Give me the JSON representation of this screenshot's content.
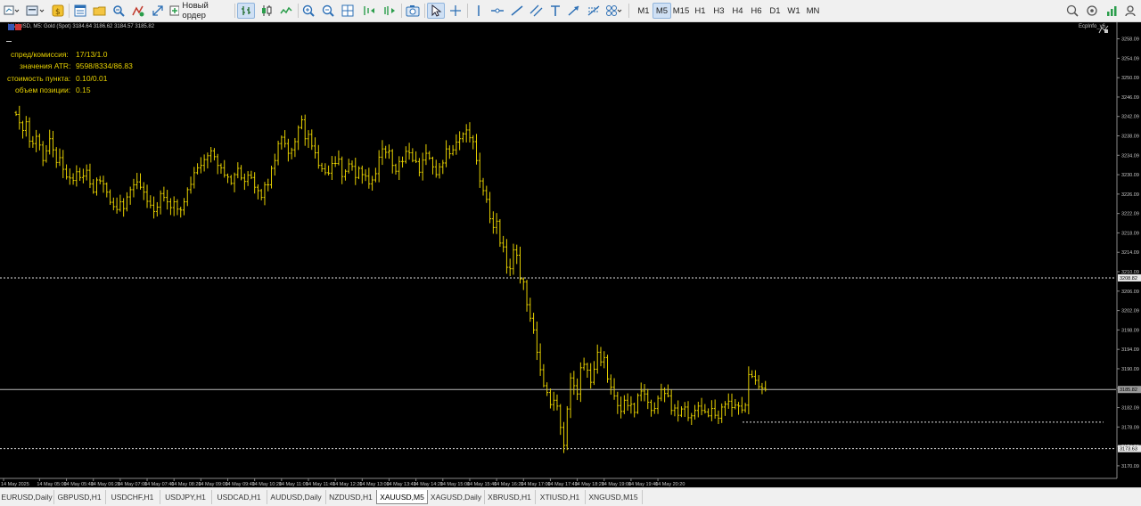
{
  "toolbar": {
    "new_order_label": "Новый ордер",
    "timeframes": [
      "M1",
      "M5",
      "M15",
      "H1",
      "H3",
      "H4",
      "H6",
      "D1",
      "W1",
      "MN"
    ],
    "active_timeframe": "M5"
  },
  "chart": {
    "header": "XAUUSD, M5:  Gold (Spot)  3184.64 3186.62 3184.57 3185.82",
    "indicator_name": "EcpInfo_v6",
    "info_panel": [
      {
        "label": "спред/комиссия:",
        "value": "17/13/1.0"
      },
      {
        "label": "значения ATR:",
        "value": "9598/8334/86.83"
      },
      {
        "label": "стоимость пункта:",
        "value": "0.10/0.01"
      },
      {
        "label": "объем позиции:",
        "value": "0.15"
      }
    ],
    "line_labels": {
      "upper": "3208.82",
      "current": "3185.82",
      "lower": "3173.63"
    },
    "colors": {
      "background": "#000000",
      "bars": "#e6d000",
      "axis_text": "#c8c8c8"
    }
  },
  "chart_data": {
    "type": "ohlc",
    "symbol": "XAUUSD",
    "timeframe": "M5",
    "y_axis_ticks": [
      3258.09,
      3254.09,
      3250.09,
      3246.09,
      3242.09,
      3238.09,
      3234.09,
      3230.09,
      3226.09,
      3222.09,
      3218.09,
      3214.09,
      3210.09,
      3206.09,
      3202.09,
      3198.09,
      3194.09,
      3190.09,
      3186.09,
      3182.09,
      3178.09,
      3174.09,
      3170.09
    ],
    "x_axis_ticks": [
      "14 May 2025",
      "14 May 05:00",
      "14 May 05:40",
      "14 May 06:20",
      "14 May 07:00",
      "14 May 07:40",
      "14 May 08:20",
      "14 May 09:00",
      "14 May 09:40",
      "14 May 10:20",
      "14 May 11:00",
      "14 May 11:40",
      "14 May 12:20",
      "14 May 13:00",
      "14 May 13:40",
      "14 May 14:20",
      "14 May 15:00",
      "14 May 15:40",
      "14 May 16:20",
      "14 May 17:00",
      "14 May 17:40",
      "14 May 18:20",
      "14 May 19:00",
      "14 May 19:40",
      "14 May 20:20"
    ],
    "horizontal_levels": [
      3208.82,
      3185.82,
      3173.63
    ],
    "dotted_range_line": 3179.1,
    "ylim": [
      3167.5,
      3261.5
    ],
    "closes": [
      3242.5,
      3240.8,
      3239.2,
      3241.0,
      3237.0,
      3236.5,
      3238.0,
      3236.2,
      3233.0,
      3235.0,
      3237.5,
      3235.2,
      3232.6,
      3233.6,
      3231.2,
      3229.6,
      3229.4,
      3228.9,
      3230.7,
      3229.5,
      3229.8,
      3231.0,
      3228.2,
      3226.5,
      3229.0,
      3228.8,
      3228.2,
      3226.5,
      3224.4,
      3223.5,
      3222.9,
      3224.5,
      3223.1,
      3225.5,
      3227.0,
      3228.0,
      3228.6,
      3227.5,
      3226.5,
      3224.6,
      3223.8,
      3222.5,
      3223.4,
      3226.2,
      3225.4,
      3224.5,
      3223.3,
      3224.5,
      3223.0,
      3222.8,
      3224.5,
      3227.0,
      3228.1,
      3230.5,
      3231.5,
      3232.0,
      3233.2,
      3234.0,
      3235.0,
      3233.8,
      3232.0,
      3231.5,
      3230.0,
      3229.6,
      3228.3,
      3230.1,
      3231.4,
      3229.4,
      3228.7,
      3230.0,
      3229.5,
      3227.5,
      3226.8,
      3225.4,
      3228.0,
      3228.0,
      3231.4,
      3233.0,
      3236.5,
      3237.8,
      3236.5,
      3234.5,
      3235.2,
      3236.9,
      3239.8,
      3241.4,
      3237.5,
      3238.4,
      3236.0,
      3234.6,
      3232.0,
      3231.3,
      3230.5,
      3230.4,
      3232.4,
      3232.4,
      3233.3,
      3229.7,
      3230.8,
      3232.3,
      3231.8,
      3229.5,
      3231.4,
      3230.1,
      3229.8,
      3228.2,
      3229.0,
      3230.3,
      3233.7,
      3235.4,
      3234.7,
      3235.0,
      3232.0,
      3230.8,
      3232.8,
      3232.8,
      3234.9,
      3234.6,
      3233.0,
      3232.8,
      3230.6,
      3233.1,
      3234.5,
      3233.5,
      3231.7,
      3230.1,
      3231.7,
      3232.5,
      3235.4,
      3234.4,
      3235.2,
      3236.8,
      3237.5,
      3238.5,
      3239.3,
      3237.7,
      3236.9,
      3233.0,
      3228.8,
      3226.8,
      3225.0,
      3221.0,
      3219.2,
      3220.5,
      3216.0,
      3215.2,
      3211.0,
      3210.7,
      3214.6,
      3213.5,
      3208.6,
      3208.0,
      3203.3,
      3200.5,
      3198.1,
      3193.5,
      3189.9,
      3186.6,
      3185.2,
      3182.7,
      3183.6,
      3182.4,
      3178.0,
      3174.3,
      3181.8,
      3188.2,
      3186.6,
      3184.9,
      3190.3,
      3191.0,
      3189.8,
      3187.3,
      3190.0,
      3193.5,
      3191.5,
      3192.4,
      3188.0,
      3186.3,
      3184.5,
      3182.5,
      3181.3,
      3183.6,
      3182.5,
      3182.8,
      3181.1,
      3184.6,
      3185.5,
      3184.9,
      3183.2,
      3181.5,
      3181.9,
      3184.0,
      3185.8,
      3185.0,
      3184.5,
      3181.5,
      3182.0,
      3180.5,
      3181.8,
      3182.2,
      3180.0,
      3180.4,
      3181.5,
      3182.4,
      3181.5,
      3181.2,
      3180.4,
      3181.9,
      3180.5,
      3179.9,
      3182.2,
      3182.8,
      3183.4,
      3182.1,
      3182.6,
      3182.4,
      3181.6,
      3182.6,
      3188.9,
      3188.5,
      3187.7,
      3186.4,
      3186.1,
      3185.8
    ]
  },
  "tabs": [
    "EURUSD,Daily",
    "GBPUSD,H1",
    "USDCHF,H1",
    "USDJPY,H1",
    "USDCAD,H1",
    "AUDUSD,Daily",
    "NZDUSD,H1",
    "XAUUSD,M5",
    "XAGUSD,Daily",
    "XBRUSD,H1",
    "XTIUSD,H1",
    "XNGUSD,M15"
  ],
  "active_tab": "XAUUSD,M5"
}
